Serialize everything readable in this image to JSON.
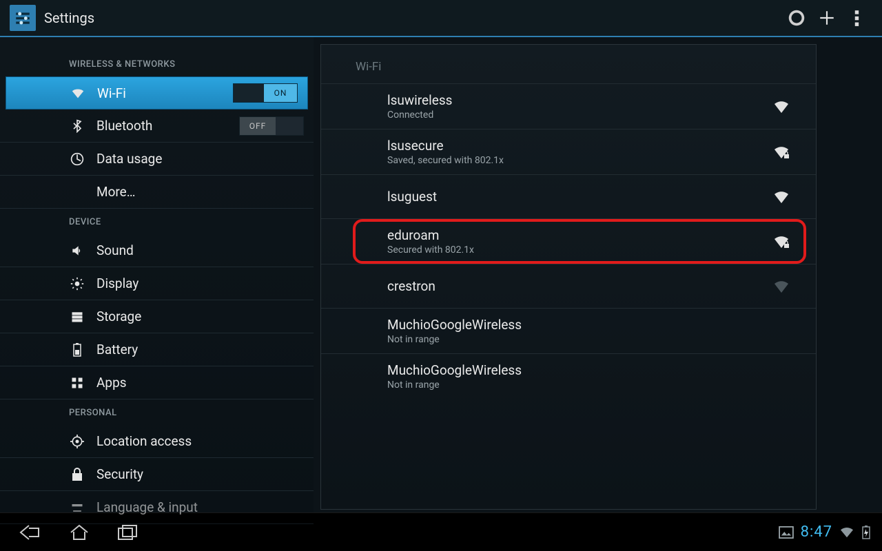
{
  "actionbar": {
    "title": "Settings"
  },
  "sections": {
    "wireless_hdr": "WIRELESS & NETWORKS",
    "device_hdr": "DEVICE",
    "personal_hdr": "PERSONAL"
  },
  "sidebar": {
    "wifi": {
      "label": "Wi-Fi",
      "toggle": "ON"
    },
    "bluetooth": {
      "label": "Bluetooth",
      "toggle": "OFF"
    },
    "datausage": {
      "label": "Data usage"
    },
    "more": {
      "label": "More…"
    },
    "sound": {
      "label": "Sound"
    },
    "display": {
      "label": "Display"
    },
    "storage": {
      "label": "Storage"
    },
    "battery": {
      "label": "Battery"
    },
    "apps": {
      "label": "Apps"
    },
    "location": {
      "label": "Location access"
    },
    "security": {
      "label": "Security"
    },
    "language": {
      "label": "Language & input"
    }
  },
  "detail": {
    "hdr": "Wi-Fi",
    "networks": [
      {
        "name": "lsuwireless",
        "sub": "Connected",
        "signal": "strong",
        "lock": false
      },
      {
        "name": "lsusecure",
        "sub": "Saved, secured with 802.1x",
        "signal": "strong",
        "lock": true
      },
      {
        "name": "lsuguest",
        "sub": "",
        "signal": "strong",
        "lock": false
      },
      {
        "name": "eduroam",
        "sub": "Secured with 802.1x",
        "signal": "strong",
        "lock": true,
        "highlight": true
      },
      {
        "name": "crestron",
        "sub": "",
        "signal": "weak",
        "lock": false
      },
      {
        "name": "MuchioGoogleWireless",
        "sub": "Not in range",
        "signal": "none",
        "lock": false
      },
      {
        "name": "MuchioGoogleWireless",
        "sub": "Not in range",
        "signal": "none",
        "lock": false
      }
    ]
  },
  "statusbar": {
    "time": "8:47"
  }
}
